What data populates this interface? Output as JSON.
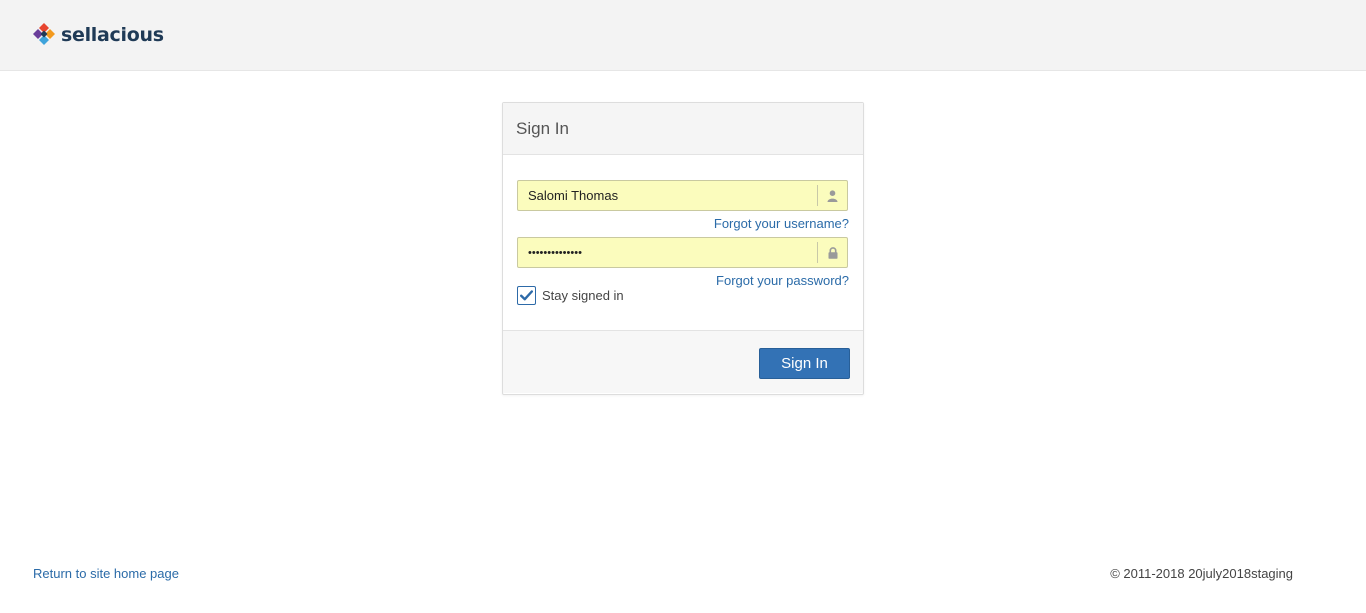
{
  "brand": {
    "name": "sellacious"
  },
  "login": {
    "title": "Sign In",
    "username_value": "Salomi Thomas",
    "password_value": "••••••••••••••",
    "forgot_username": "Forgot your username?",
    "forgot_password": "Forgot your password?",
    "remember_label": "Stay signed in",
    "remember_checked": true,
    "submit_label": "Sign In"
  },
  "footer": {
    "home_link": "Return to site home page",
    "copyright": "© 2011-2018 20july2018staging"
  },
  "colors": {
    "accent": "#3372b5",
    "link": "#2b6ba8",
    "autofill": "#fbfcbd",
    "header_bg": "#f3f3f3"
  },
  "icons": {
    "username": "user-icon",
    "password": "lock-icon",
    "checkbox": "check-icon"
  }
}
